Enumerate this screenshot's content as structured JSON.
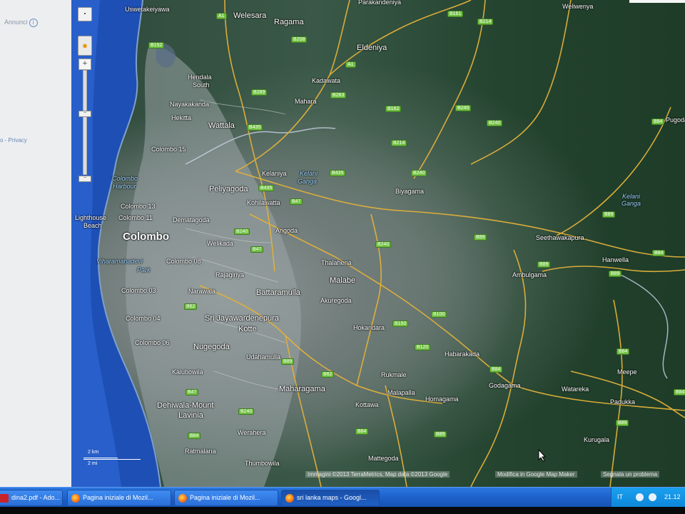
{
  "sidebar": {
    "ads_label": "Annunci",
    "info_icon": "i",
    "privacy_link": "so - Privacy"
  },
  "map": {
    "places": [
      {
        "text": "Uswetakeiyawa",
        "size": "small",
        "water": false
      },
      {
        "text": "Welesara",
        "size": "mid",
        "water": false
      },
      {
        "text": "Ragama",
        "size": "mid",
        "water": false
      },
      {
        "text": "Eldeniya",
        "size": "mid",
        "water": false
      },
      {
        "text": "Parakandeniya",
        "size": "small",
        "water": false
      },
      {
        "text": "Weliwenya",
        "size": "small",
        "water": false
      },
      {
        "text": "Hendala",
        "size": "small",
        "water": false
      },
      {
        "text": "South",
        "size": "small",
        "water": false
      },
      {
        "text": "Nayakakanda",
        "size": "small",
        "water": false
      },
      {
        "text": "Hekitta",
        "size": "small",
        "water": false
      },
      {
        "text": "Kadawata",
        "size": "small",
        "water": false
      },
      {
        "text": "Mahara",
        "size": "small",
        "water": false
      },
      {
        "text": "Wattala",
        "size": "mid",
        "water": false
      },
      {
        "text": "Colombo 15",
        "size": "small",
        "water": false
      },
      {
        "text": "Kelaniya",
        "size": "small",
        "water": false
      },
      {
        "text": "Kelani",
        "size": "small",
        "water": true
      },
      {
        "text": "Ganga",
        "size": "small",
        "water": true
      },
      {
        "text": "Colombo",
        "size": "small",
        "water": true
      },
      {
        "text": "Harbour",
        "size": "small",
        "water": true
      },
      {
        "text": "Peliyagoda",
        "size": "mid",
        "water": false
      },
      {
        "text": "Biyagama",
        "size": "small",
        "water": false
      },
      {
        "text": "Kohilawatta",
        "size": "small",
        "water": false
      },
      {
        "text": "Colombo 13",
        "size": "small",
        "water": false
      },
      {
        "text": "Lighthouse",
        "size": "small",
        "water": false
      },
      {
        "text": "Beach",
        "size": "small",
        "water": false
      },
      {
        "text": "Colombo 11",
        "size": "small",
        "water": false
      },
      {
        "text": "Dematagoda",
        "size": "small",
        "water": false
      },
      {
        "text": "Angoda",
        "size": "small",
        "water": false
      },
      {
        "text": "Colombo",
        "size": "big",
        "water": false
      },
      {
        "text": "Welikada",
        "size": "small",
        "water": false
      },
      {
        "text": "Viharamahadevi",
        "size": "small",
        "water": true
      },
      {
        "text": "Park",
        "size": "small",
        "water": true
      },
      {
        "text": "Colombo 08",
        "size": "small",
        "water": false
      },
      {
        "text": "Thalahena",
        "size": "small",
        "water": false
      },
      {
        "text": "Rajagiriya",
        "size": "small",
        "water": false
      },
      {
        "text": "Colombo 03",
        "size": "small",
        "water": false
      },
      {
        "text": "Narawala",
        "size": "small",
        "water": false
      },
      {
        "text": "Battaramulla",
        "size": "mid",
        "water": false
      },
      {
        "text": "Malabe",
        "size": "mid",
        "water": false
      },
      {
        "text": "Akuregoda",
        "size": "small",
        "water": false
      },
      {
        "text": "Sri Jayawardenepura",
        "size": "mid",
        "water": false
      },
      {
        "text": "Kotte",
        "size": "mid",
        "water": false
      },
      {
        "text": "Colombo 04",
        "size": "small",
        "water": false
      },
      {
        "text": "Hokandara",
        "size": "small",
        "water": false
      },
      {
        "text": "Colombo 06",
        "size": "small",
        "water": false
      },
      {
        "text": "Nugegoda",
        "size": "mid",
        "water": false
      },
      {
        "text": "Udahamulla",
        "size": "small",
        "water": false
      },
      {
        "text": "Habarakada",
        "size": "small",
        "water": false
      },
      {
        "text": "Kalubowila",
        "size": "small",
        "water": false
      },
      {
        "text": "Rukmale",
        "size": "small",
        "water": false
      },
      {
        "text": "Maharagama",
        "size": "mid",
        "water": false
      },
      {
        "text": "Malapalla",
        "size": "small",
        "water": false
      },
      {
        "text": "Homagama",
        "size": "small",
        "water": false
      },
      {
        "text": "Godagama",
        "size": "small",
        "water": false
      },
      {
        "text": "Dehiwala-Mount",
        "size": "mid",
        "water": false
      },
      {
        "text": "Lavinia",
        "size": "mid",
        "water": false
      },
      {
        "text": "Kottawa",
        "size": "small",
        "water": false
      },
      {
        "text": "Werahera",
        "size": "small",
        "water": false
      },
      {
        "text": "Ratmalana",
        "size": "small",
        "water": false
      },
      {
        "text": "Thumbowila",
        "size": "small",
        "water": false
      },
      {
        "text": "Mattegoda",
        "size": "small",
        "water": false
      },
      {
        "text": "Seethawakapura",
        "size": "small",
        "water": false
      },
      {
        "text": "Hanwella",
        "size": "small",
        "water": false
      },
      {
        "text": "Ambulgama",
        "size": "small",
        "water": false
      },
      {
        "text": "Kelani",
        "size": "small",
        "water": true
      },
      {
        "text": "Ganga",
        "size": "small",
        "water": true
      },
      {
        "text": "Pugoda",
        "size": "small",
        "water": false
      },
      {
        "text": "Meepe",
        "size": "small",
        "water": false
      },
      {
        "text": "Watareka",
        "size": "small",
        "water": false
      },
      {
        "text": "Padukka",
        "size": "small",
        "water": false
      },
      {
        "text": "Kurugala",
        "size": "small",
        "water": false
      }
    ],
    "road_badges": [
      "A1",
      "A1",
      "B152",
      "B208",
      "B161",
      "B214",
      "B263",
      "B289",
      "B162",
      "B435",
      "B240",
      "B240",
      "B214",
      "B435",
      "B240",
      "B435",
      "B47",
      "B240",
      "B240",
      "B89",
      "B47",
      "B89",
      "B89",
      "B89",
      "B84",
      "B62",
      "B100",
      "B150",
      "B120",
      "B84",
      "B84",
      "B62",
      "B84",
      "B89",
      "B89",
      "B47",
      "B240",
      "B89",
      "B84",
      "B84",
      "B84"
    ],
    "zoom": {
      "pan": "⬝",
      "plus": "+",
      "minus": "−",
      "thumb1": "−",
      "thumb2": "−"
    },
    "scale": {
      "km": "2 km",
      "mi": "2 mi"
    },
    "attribution": {
      "imagery": "Immagini ©2013 TerraMetrics, Map data ©2013 Google",
      "edit": "Modifica in Google Map Maker",
      "report": "Segnala un problema"
    }
  },
  "taskbar": {
    "tasks": [
      {
        "label": "dina2.pdf - Ado...",
        "icon": "pdf",
        "active": false
      },
      {
        "label": "Pagina iniziale di Mozil...",
        "icon": "firefox",
        "active": false
      },
      {
        "label": "Pagina iniziale di Mozil...",
        "icon": "firefox",
        "active": false
      },
      {
        "label": "sri lanka maps - Googl...",
        "icon": "firefox",
        "active": true
      }
    ],
    "tray": {
      "lang": "IT",
      "clock": "21.12"
    }
  }
}
